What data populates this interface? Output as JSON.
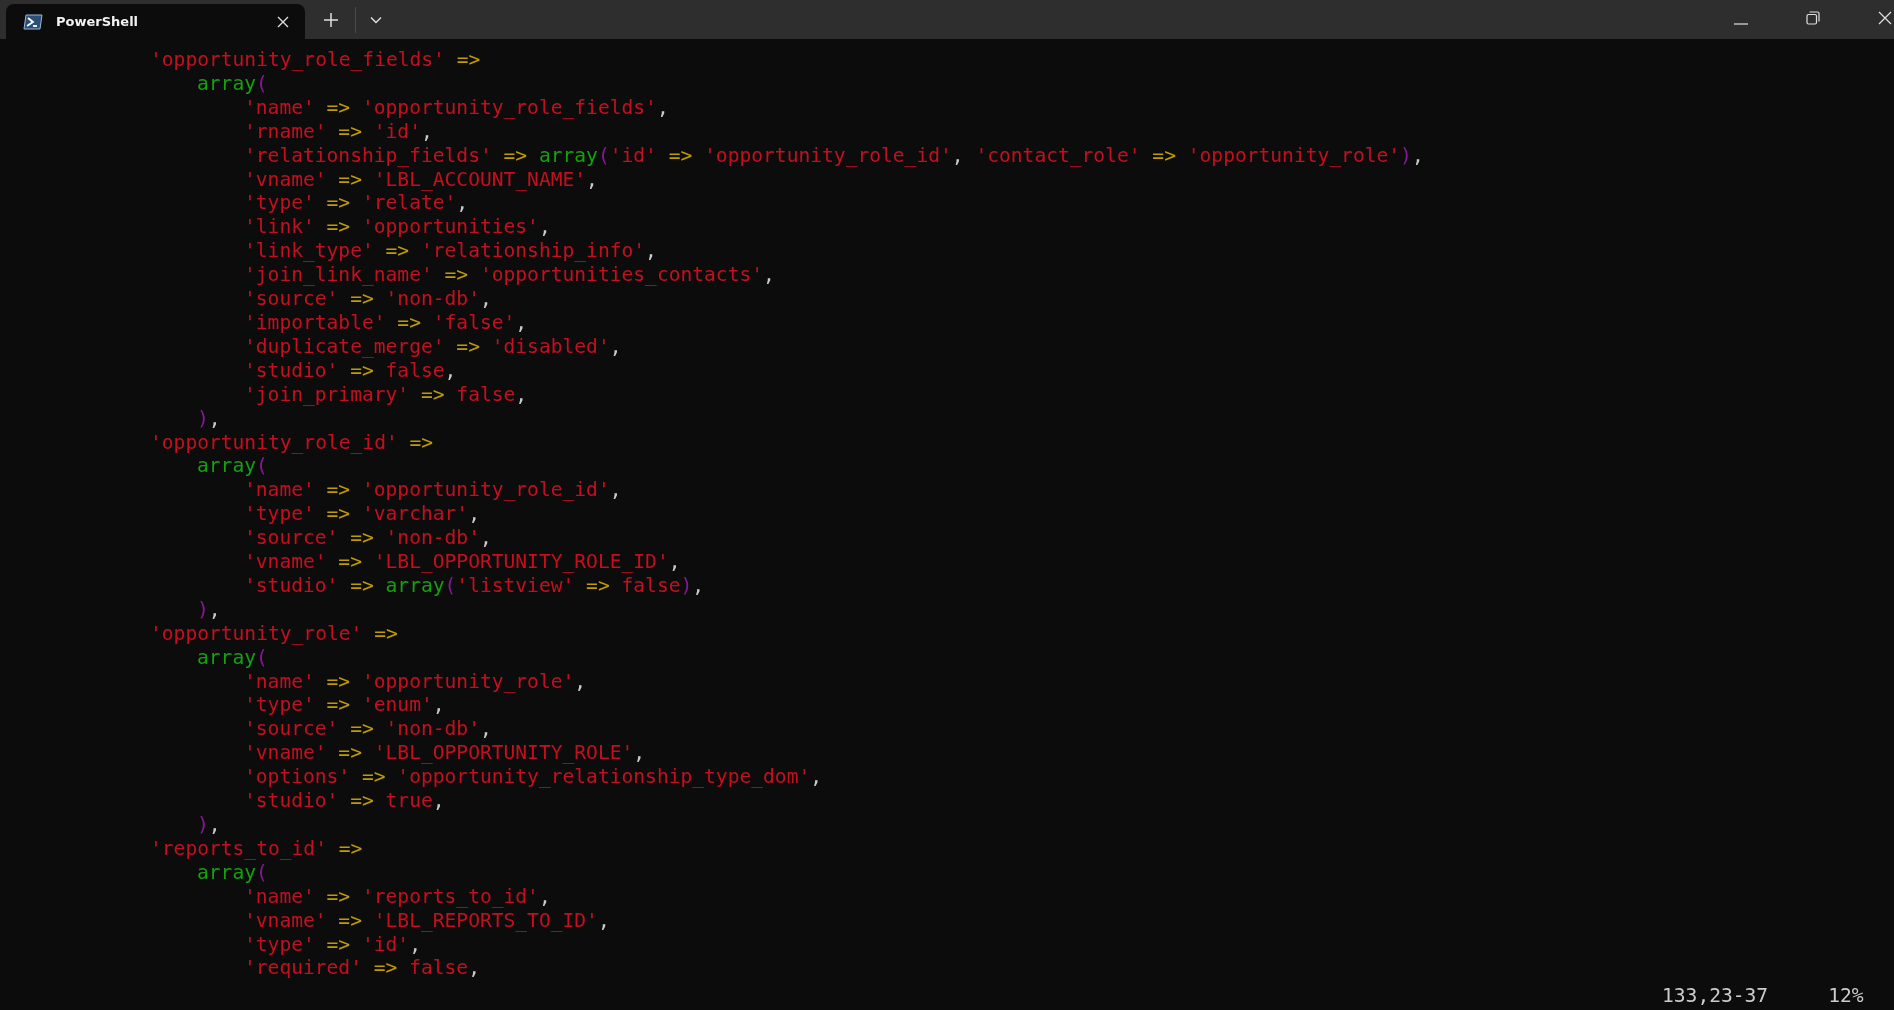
{
  "tab": {
    "title": "PowerShell",
    "selected": true
  },
  "blocks": [
    {
      "head": [
        {
          "kind": "str",
          "text": "'opportunity_role_fields'"
        },
        {
          "kind": "op",
          "text": " =>"
        }
      ],
      "open": [
        {
          "kind": "kw",
          "text": "array"
        },
        {
          "kind": "paren",
          "text": "("
        }
      ],
      "fields": [
        [
          {
            "kind": "str",
            "text": "'name'"
          },
          {
            "kind": "op",
            "text": " => "
          },
          {
            "kind": "str",
            "text": "'opportunity_role_fields'"
          },
          {
            "kind": "punct",
            "text": ","
          }
        ],
        [
          {
            "kind": "str",
            "text": "'rname'"
          },
          {
            "kind": "op",
            "text": " => "
          },
          {
            "kind": "str",
            "text": "'id'"
          },
          {
            "kind": "punct",
            "text": ","
          }
        ],
        [
          {
            "kind": "str",
            "text": "'relationship_fields'"
          },
          {
            "kind": "op",
            "text": " => "
          },
          {
            "kind": "kw",
            "text": "array"
          },
          {
            "kind": "paren",
            "text": "("
          },
          {
            "kind": "str",
            "text": "'id'"
          },
          {
            "kind": "op",
            "text": " => "
          },
          {
            "kind": "str",
            "text": "'opportunity_role_id'"
          },
          {
            "kind": "punct",
            "text": ", "
          },
          {
            "kind": "str",
            "text": "'contact_role'"
          },
          {
            "kind": "op",
            "text": " => "
          },
          {
            "kind": "str",
            "text": "'opportunity_role'"
          },
          {
            "kind": "paren",
            "text": ")"
          },
          {
            "kind": "punct",
            "text": ","
          }
        ],
        [
          {
            "kind": "str",
            "text": "'vname'"
          },
          {
            "kind": "op",
            "text": " => "
          },
          {
            "kind": "str",
            "text": "'LBL_ACCOUNT_NAME'"
          },
          {
            "kind": "punct",
            "text": ","
          }
        ],
        [
          {
            "kind": "str",
            "text": "'type'"
          },
          {
            "kind": "op",
            "text": " => "
          },
          {
            "kind": "str",
            "text": "'relate'"
          },
          {
            "kind": "punct",
            "text": ","
          }
        ],
        [
          {
            "kind": "str",
            "text": "'link'"
          },
          {
            "kind": "op",
            "text": " => "
          },
          {
            "kind": "str",
            "text": "'opportunities'"
          },
          {
            "kind": "punct",
            "text": ","
          }
        ],
        [
          {
            "kind": "str",
            "text": "'link_type'"
          },
          {
            "kind": "op",
            "text": " => "
          },
          {
            "kind": "str",
            "text": "'relationship_info'"
          },
          {
            "kind": "punct",
            "text": ","
          }
        ],
        [
          {
            "kind": "str",
            "text": "'join_link_name'"
          },
          {
            "kind": "op",
            "text": " => "
          },
          {
            "kind": "str",
            "text": "'opportunities_contacts'"
          },
          {
            "kind": "punct",
            "text": ","
          }
        ],
        [
          {
            "kind": "str",
            "text": "'source'"
          },
          {
            "kind": "op",
            "text": " => "
          },
          {
            "kind": "str",
            "text": "'non-db'"
          },
          {
            "kind": "punct",
            "text": ","
          }
        ],
        [
          {
            "kind": "str",
            "text": "'importable'"
          },
          {
            "kind": "op",
            "text": " => "
          },
          {
            "kind": "str",
            "text": "'false'"
          },
          {
            "kind": "punct",
            "text": ","
          }
        ],
        [
          {
            "kind": "str",
            "text": "'duplicate_merge'"
          },
          {
            "kind": "op",
            "text": " => "
          },
          {
            "kind": "str",
            "text": "'disabled'"
          },
          {
            "kind": "punct",
            "text": ","
          }
        ],
        [
          {
            "kind": "str",
            "text": "'studio'"
          },
          {
            "kind": "op",
            "text": " => "
          },
          {
            "kind": "bool",
            "text": "false"
          },
          {
            "kind": "punct",
            "text": ","
          }
        ],
        [
          {
            "kind": "str",
            "text": "'join_primary'"
          },
          {
            "kind": "op",
            "text": " => "
          },
          {
            "kind": "bool",
            "text": "false"
          },
          {
            "kind": "punct",
            "text": ","
          }
        ]
      ],
      "close": [
        {
          "kind": "paren",
          "text": ")"
        },
        {
          "kind": "punct",
          "text": ","
        }
      ]
    },
    {
      "head": [
        {
          "kind": "str",
          "text": "'opportunity_role_id'"
        },
        {
          "kind": "op",
          "text": " =>"
        }
      ],
      "open": [
        {
          "kind": "kw",
          "text": "array"
        },
        {
          "kind": "paren",
          "text": "("
        }
      ],
      "fields": [
        [
          {
            "kind": "str",
            "text": "'name'"
          },
          {
            "kind": "op",
            "text": " => "
          },
          {
            "kind": "str",
            "text": "'opportunity_role_id'"
          },
          {
            "kind": "punct",
            "text": ","
          }
        ],
        [
          {
            "kind": "str",
            "text": "'type'"
          },
          {
            "kind": "op",
            "text": " => "
          },
          {
            "kind": "str",
            "text": "'varchar'"
          },
          {
            "kind": "punct",
            "text": ","
          }
        ],
        [
          {
            "kind": "str",
            "text": "'source'"
          },
          {
            "kind": "op",
            "text": " => "
          },
          {
            "kind": "str",
            "text": "'non-db'"
          },
          {
            "kind": "punct",
            "text": ","
          }
        ],
        [
          {
            "kind": "str",
            "text": "'vname'"
          },
          {
            "kind": "op",
            "text": " => "
          },
          {
            "kind": "str",
            "text": "'LBL_OPPORTUNITY_ROLE_ID'"
          },
          {
            "kind": "punct",
            "text": ","
          }
        ],
        [
          {
            "kind": "str",
            "text": "'studio'"
          },
          {
            "kind": "op",
            "text": " => "
          },
          {
            "kind": "kw",
            "text": "array"
          },
          {
            "kind": "paren",
            "text": "("
          },
          {
            "kind": "str",
            "text": "'listview'"
          },
          {
            "kind": "op",
            "text": " => "
          },
          {
            "kind": "bool",
            "text": "false"
          },
          {
            "kind": "paren",
            "text": ")"
          },
          {
            "kind": "punct",
            "text": ","
          }
        ]
      ],
      "close": [
        {
          "kind": "paren",
          "text": ")"
        },
        {
          "kind": "punct",
          "text": ","
        }
      ]
    },
    {
      "head": [
        {
          "kind": "str",
          "text": "'opportunity_role'"
        },
        {
          "kind": "op",
          "text": " =>"
        }
      ],
      "open": [
        {
          "kind": "kw",
          "text": "array"
        },
        {
          "kind": "paren",
          "text": "("
        }
      ],
      "fields": [
        [
          {
            "kind": "str",
            "text": "'name'"
          },
          {
            "kind": "op",
            "text": " => "
          },
          {
            "kind": "str",
            "text": "'opportunity_role'"
          },
          {
            "kind": "punct",
            "text": ","
          }
        ],
        [
          {
            "kind": "str",
            "text": "'type'"
          },
          {
            "kind": "op",
            "text": " => "
          },
          {
            "kind": "str",
            "text": "'enum'"
          },
          {
            "kind": "punct",
            "text": ","
          }
        ],
        [
          {
            "kind": "str",
            "text": "'source'"
          },
          {
            "kind": "op",
            "text": " => "
          },
          {
            "kind": "str",
            "text": "'non-db'"
          },
          {
            "kind": "punct",
            "text": ","
          }
        ],
        [
          {
            "kind": "str",
            "text": "'vname'"
          },
          {
            "kind": "op",
            "text": " => "
          },
          {
            "kind": "str",
            "text": "'LBL_OPPORTUNITY_ROLE'"
          },
          {
            "kind": "punct",
            "text": ","
          }
        ],
        [
          {
            "kind": "str",
            "text": "'options'"
          },
          {
            "kind": "op",
            "text": " => "
          },
          {
            "kind": "str",
            "text": "'opportunity_relationship_type_dom'"
          },
          {
            "kind": "punct",
            "text": ","
          }
        ],
        [
          {
            "kind": "str",
            "text": "'studio'"
          },
          {
            "kind": "op",
            "text": " => "
          },
          {
            "kind": "bool",
            "text": "true"
          },
          {
            "kind": "punct",
            "text": ","
          }
        ]
      ],
      "close": [
        {
          "kind": "paren",
          "text": ")"
        },
        {
          "kind": "punct",
          "text": ","
        }
      ]
    },
    {
      "head": [
        {
          "kind": "str",
          "text": "'reports_to_id'"
        },
        {
          "kind": "op",
          "text": " =>"
        }
      ],
      "open": [
        {
          "kind": "kw",
          "text": "array"
        },
        {
          "kind": "paren",
          "text": "("
        }
      ],
      "fields": [
        [
          {
            "kind": "str",
            "text": "'name'"
          },
          {
            "kind": "op",
            "text": " => "
          },
          {
            "kind": "str",
            "text": "'reports_to_id'"
          },
          {
            "kind": "punct",
            "text": ","
          }
        ],
        [
          {
            "kind": "str",
            "text": "'vname'"
          },
          {
            "kind": "op",
            "text": " => "
          },
          {
            "kind": "str",
            "text": "'LBL_REPORTS_TO_ID'"
          },
          {
            "kind": "punct",
            "text": ","
          }
        ],
        [
          {
            "kind": "str",
            "text": "'type'"
          },
          {
            "kind": "op",
            "text": " => "
          },
          {
            "kind": "str",
            "text": "'id'"
          },
          {
            "kind": "punct",
            "text": ","
          }
        ],
        [
          {
            "kind": "str",
            "text": "'required'"
          },
          {
            "kind": "op",
            "text": " => "
          },
          {
            "kind": "bool",
            "text": "false"
          },
          {
            "kind": "punct",
            "text": ","
          }
        ]
      ]
    }
  ],
  "status": {
    "position": "133,23-37",
    "percent": "12%"
  }
}
